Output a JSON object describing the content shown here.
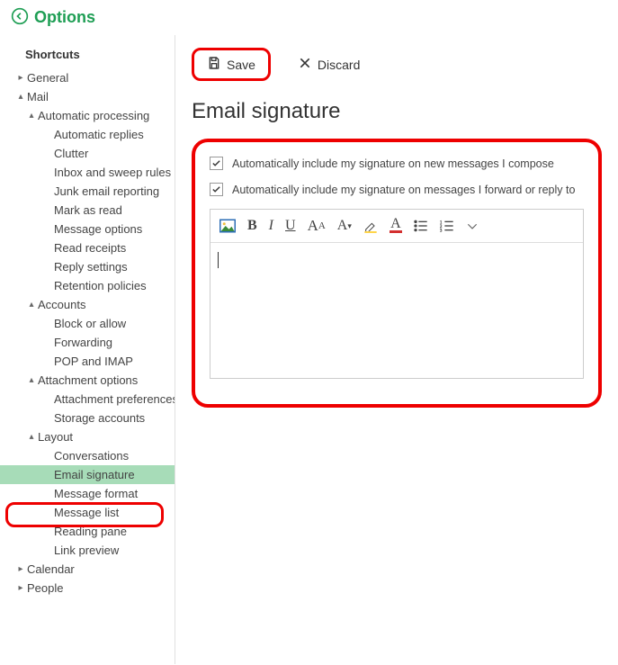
{
  "header": {
    "title": "Options"
  },
  "sidebar": {
    "shortcuts_label": "Shortcuts",
    "general": "General",
    "mail": "Mail",
    "automatic_processing": "Automatic processing",
    "automatic_replies": "Automatic replies",
    "clutter": "Clutter",
    "inbox_sweep": "Inbox and sweep rules",
    "junk_reporting": "Junk email reporting",
    "mark_read": "Mark as read",
    "message_options": "Message options",
    "read_receipts": "Read receipts",
    "reply_settings": "Reply settings",
    "retention_policies": "Retention policies",
    "accounts": "Accounts",
    "block_allow": "Block or allow",
    "forwarding": "Forwarding",
    "pop_imap": "POP and IMAP",
    "attachment_options": "Attachment options",
    "attachment_prefs": "Attachment preferences",
    "storage_accounts": "Storage accounts",
    "layout": "Layout",
    "conversations": "Conversations",
    "email_signature": "Email signature",
    "message_format": "Message format",
    "message_list": "Message list",
    "reading_pane": "Reading pane",
    "link_preview": "Link preview",
    "calendar": "Calendar",
    "people": "People"
  },
  "toolbar": {
    "save_label": "Save",
    "discard_label": "Discard"
  },
  "page": {
    "title": "Email signature",
    "opt1": "Automatically include my signature on new messages I compose",
    "opt2": "Automatically include my signature on messages I forward or reply to",
    "opt1_checked": true,
    "opt2_checked": true
  }
}
